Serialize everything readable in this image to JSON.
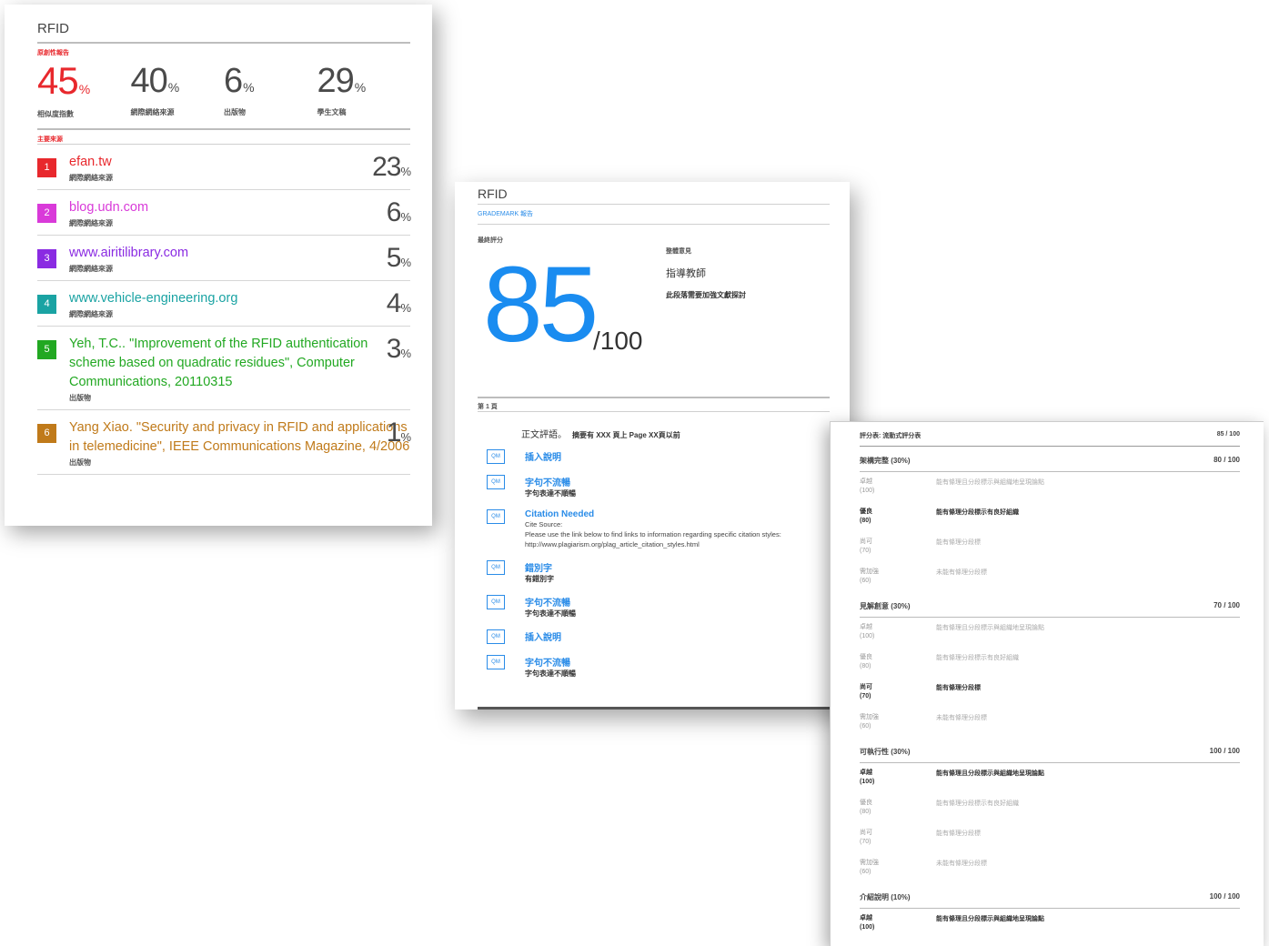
{
  "card1": {
    "title": "RFID",
    "section_label": "原創性報告",
    "stats": [
      {
        "value": "45",
        "unit": "%",
        "label": "相似度指數"
      },
      {
        "value": "40",
        "unit": "%",
        "label": "網際網絡來源"
      },
      {
        "value": "6",
        "unit": "%",
        "label": "出版物"
      },
      {
        "value": "29",
        "unit": "%",
        "label": "學生文稿"
      }
    ],
    "sources_label": "主要來源",
    "sources": [
      {
        "rank": "1",
        "name": "efan.tw",
        "type": "網際網絡來源",
        "percent": "23",
        "unit": "%",
        "color": "#e8282d"
      },
      {
        "rank": "2",
        "name": "blog.udn.com",
        "type": "網際網絡來源",
        "percent": "6",
        "unit": "%",
        "color": "#d93ad9"
      },
      {
        "rank": "3",
        "name": "www.airitilibrary.com",
        "type": "網際網絡來源",
        "percent": "5",
        "unit": "%",
        "color": "#8a2be2"
      },
      {
        "rank": "4",
        "name": "www.vehicle-engineering.org",
        "type": "網際網絡來源",
        "percent": "4",
        "unit": "%",
        "color": "#1aa3a3"
      },
      {
        "rank": "5",
        "name": "Yeh, T.C.. \"Improvement of the RFID authentication scheme based on quadratic residues\", Computer Communications, 20110315",
        "type": "出版物",
        "percent": "3",
        "unit": "%",
        "color": "#22a822"
      },
      {
        "rank": "6",
        "name": "Yang Xiao. \"Security and privacy in RFID and applications in telemedicine\", IEEE Communications Magazine, 4/2006",
        "type": "出版物",
        "percent": "1",
        "unit": "%",
        "color": "#c07a1a"
      }
    ]
  },
  "card2": {
    "title": "RFID",
    "grademark_label": "GRADEMARK 報告",
    "final_grade_label": "最終評分",
    "score": "85",
    "score_total": "/100",
    "general_comment_label": "整體意見",
    "rater": "指導教師",
    "rater_note": "此段落需要加強文獻探討",
    "page_label": "第 1 頁",
    "comment_header": "正文評語。",
    "comment_header_sub": "摘要有 XXX 頁上 Page XX頁以前",
    "comments": [
      {
        "icon": "QM",
        "title": "插入說明",
        "sub": "",
        "desc": []
      },
      {
        "icon": "QM",
        "title": "字句不流暢",
        "sub": "字句表達不順暢",
        "desc": []
      },
      {
        "icon": "QM",
        "title": "Citation Needed",
        "sub": "",
        "desc": [
          "Cite Source:",
          "Please use the link below to find links to information regarding specific citation styles:",
          "http://www.plagiarism.org/plag_article_citation_styles.html"
        ]
      },
      {
        "icon": "QM",
        "title": "錯別字",
        "sub": "有錯別字",
        "desc": []
      },
      {
        "icon": "QM",
        "title": "字句不流暢",
        "sub": "字句表達不順暢",
        "desc": []
      },
      {
        "icon": "QM",
        "title": "插入說明",
        "sub": "",
        "desc": []
      },
      {
        "icon": "QM",
        "title": "字句不流暢",
        "sub": "字句表達不順暢",
        "desc": []
      }
    ]
  },
  "card3": {
    "header_left": "評分表: 流動式評分表",
    "header_right": "85 / 100",
    "sections": [
      {
        "title": "架構完整 (30%)",
        "score": "80 / 100",
        "rows": [
          {
            "level": "卓越",
            "points": "(100)",
            "desc": "能有條理且分段標示與組織地呈現論點",
            "selected": false
          },
          {
            "level": "優良",
            "points": "(80)",
            "desc": "能有條理分段標示有良好組織",
            "selected": true
          },
          {
            "level": "尚可",
            "points": "(70)",
            "desc": "能有條理分段標",
            "selected": false
          },
          {
            "level": "需加強",
            "points": "(60)",
            "desc": "未能有條理分段標",
            "selected": false
          }
        ]
      },
      {
        "title": "見解創意 (30%)",
        "score": "70 / 100",
        "rows": [
          {
            "level": "卓越",
            "points": "(100)",
            "desc": "能有條理且分段標示與組織地呈現論點",
            "selected": false
          },
          {
            "level": "優良",
            "points": "(80)",
            "desc": "能有條理分段標示有良好組織",
            "selected": false
          },
          {
            "level": "尚可",
            "points": "(70)",
            "desc": "能有條理分段標",
            "selected": true
          },
          {
            "level": "需加強",
            "points": "(60)",
            "desc": "未能有條理分段標",
            "selected": false
          }
        ]
      },
      {
        "title": "可執行性 (30%)",
        "score": "100 / 100",
        "rows": [
          {
            "level": "卓越",
            "points": "(100)",
            "desc": "能有條理且分段標示與組織地呈現論點",
            "selected": true
          },
          {
            "level": "優良",
            "points": "(80)",
            "desc": "能有條理分段標示有良好組織",
            "selected": false
          },
          {
            "level": "尚可",
            "points": "(70)",
            "desc": "能有條理分段標",
            "selected": false
          },
          {
            "level": "需加強",
            "points": "(60)",
            "desc": "未能有條理分段標",
            "selected": false
          }
        ]
      },
      {
        "title": "介紹說明 (10%)",
        "score": "100 / 100",
        "rows": [
          {
            "level": "卓越",
            "points": "(100)",
            "desc": "能有條理且分段標示與組織地呈現論點",
            "selected": true
          }
        ]
      }
    ]
  }
}
